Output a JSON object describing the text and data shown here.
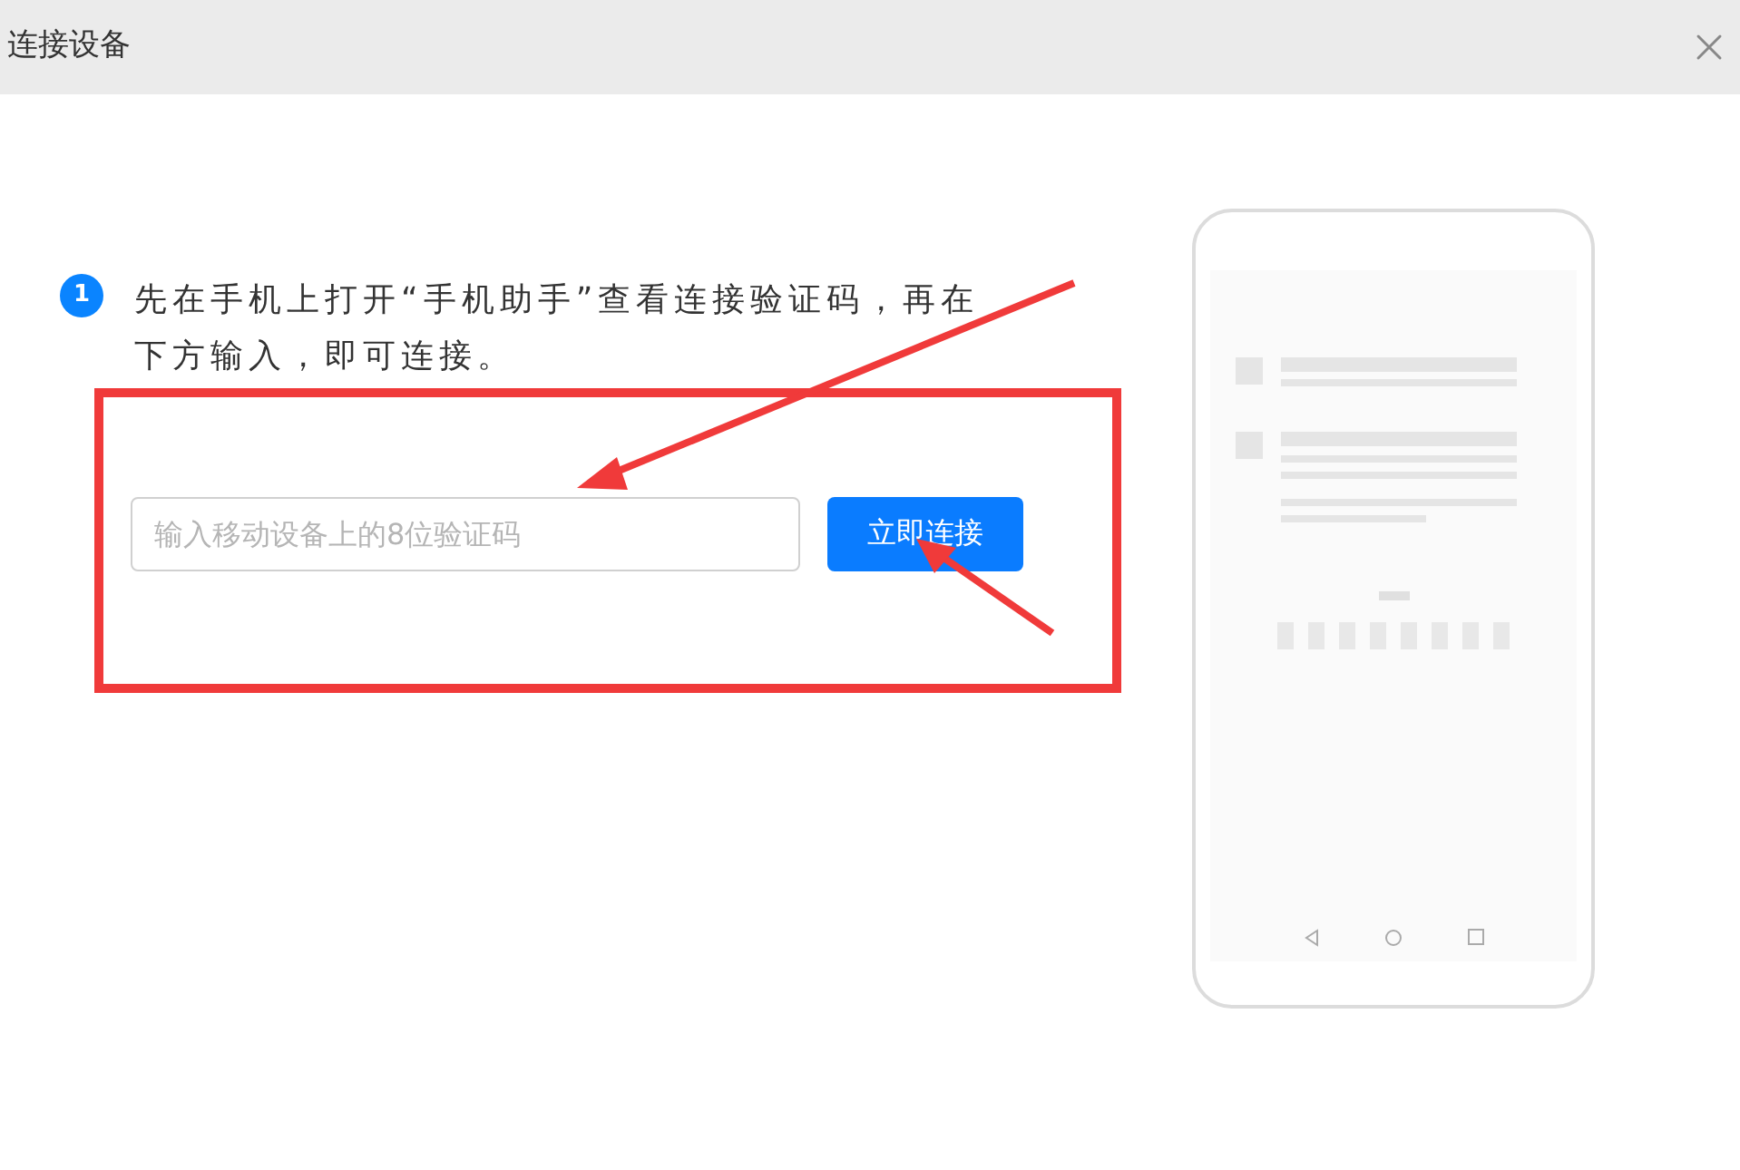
{
  "window": {
    "title": "连接设备"
  },
  "step": {
    "number": "1",
    "text": "先在手机上打开“手机助手”查看连接验证码，再在下方输入，即可连接。"
  },
  "code_field": {
    "placeholder": "输入移动设备上的8位验证码"
  },
  "connect_button": {
    "label": "立即连接"
  }
}
